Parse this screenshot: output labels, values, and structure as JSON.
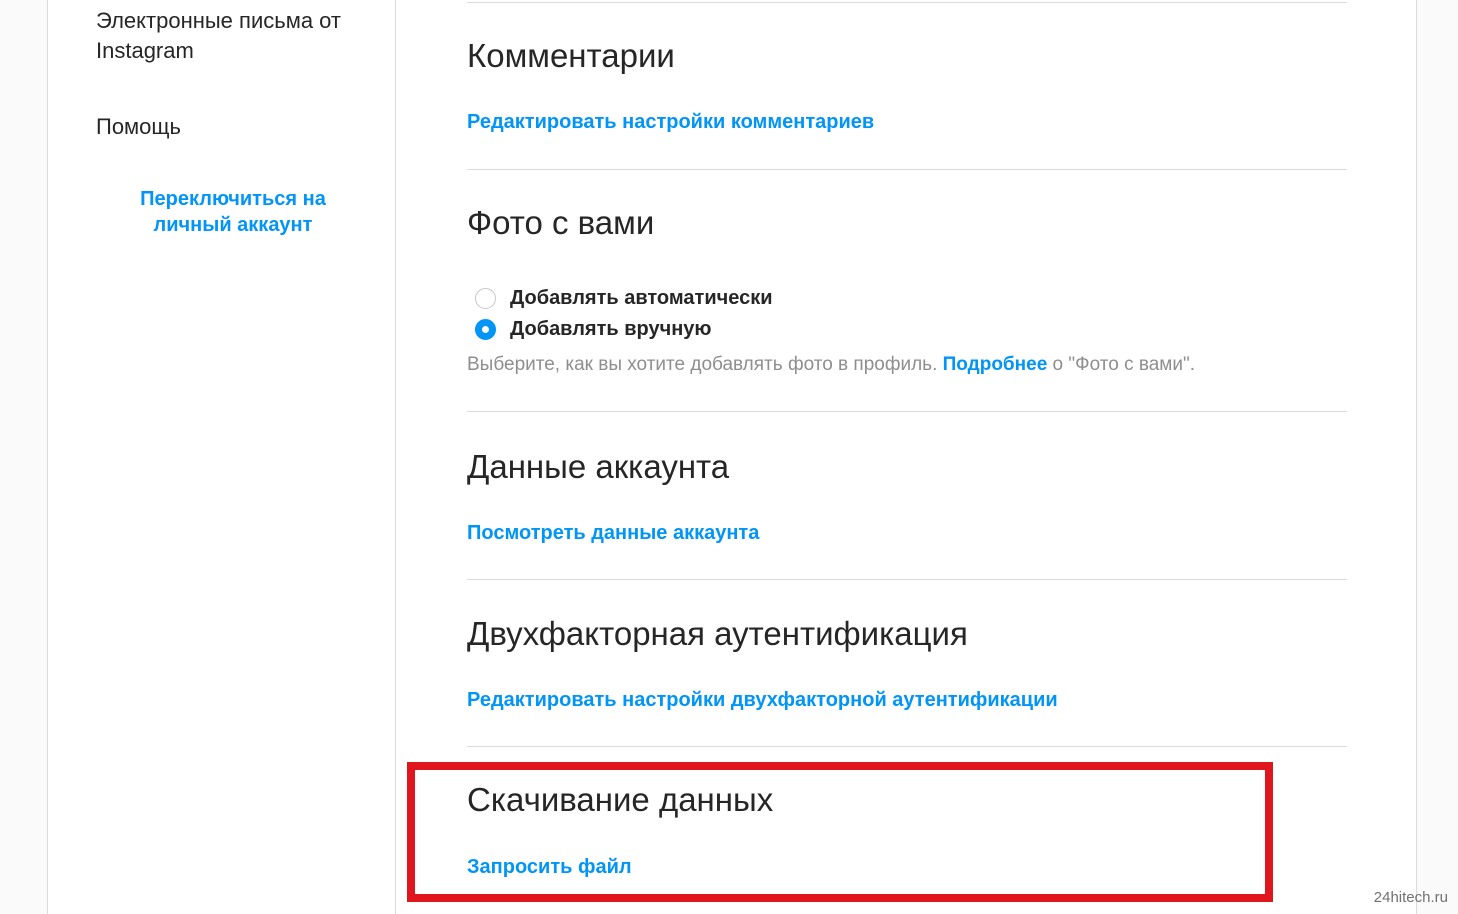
{
  "sidebar": {
    "items": [
      {
        "label": "Электронные письма от Instagram"
      },
      {
        "label": "Помощь"
      }
    ],
    "switch_account_label": "Переключиться на личный аккаунт"
  },
  "sections": {
    "comments": {
      "title": "Комментарии",
      "link": "Редактировать настройки комментариев"
    },
    "photos_of_you": {
      "title": "Фото с вами",
      "options": [
        {
          "label": "Добавлять автоматически",
          "checked": false
        },
        {
          "label": "Добавлять вручную",
          "checked": true
        }
      ],
      "help_prefix": "Выберите, как вы хотите добавлять фото в профиль. ",
      "help_link": "Подробнее",
      "help_suffix": " о \"Фото с вами\"."
    },
    "account_data": {
      "title": "Данные аккаунта",
      "link": "Посмотреть данные аккаунта"
    },
    "two_factor": {
      "title": "Двухфакторная аутентификация",
      "link": "Редактировать настройки двухфакторной аутентификации"
    },
    "data_download": {
      "title": "Скачивание данных",
      "link": "Запросить файл"
    }
  },
  "watermark": "24hitech.ru",
  "colors": {
    "link": "#0095f6",
    "highlight": "#e0161e",
    "divider": "#dbdbdb",
    "muted_text": "#8e8e8e"
  }
}
